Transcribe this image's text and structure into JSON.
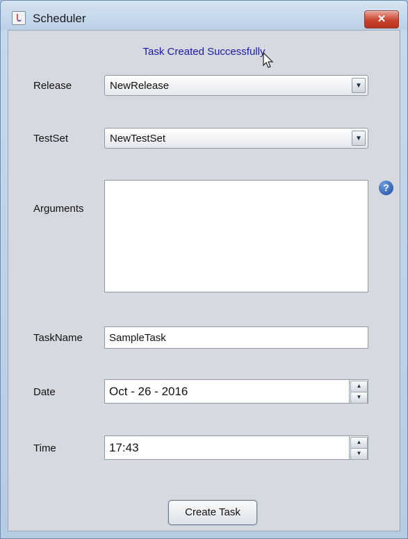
{
  "window": {
    "title": "Scheduler",
    "close_label": "✕"
  },
  "status_message": "Task Created Successfully",
  "form": {
    "release": {
      "label": "Release",
      "value": "NewRelease"
    },
    "testset": {
      "label": "TestSet",
      "value": "NewTestSet"
    },
    "arguments": {
      "label": "Arguments",
      "value": "",
      "help_icon": "?"
    },
    "taskname": {
      "label": "TaskName",
      "value": "SampleTask"
    },
    "date": {
      "label": "Date",
      "value": "Oct - 26 - 2016"
    },
    "time": {
      "label": "Time",
      "value": "17:43"
    }
  },
  "buttons": {
    "create_task": "Create Task"
  },
  "icons": {
    "dropdown": "▼",
    "spin_up": "▲",
    "spin_down": "▼"
  },
  "colors": {
    "status_text": "#1a1aa8",
    "close_button": "#c9442f"
  }
}
